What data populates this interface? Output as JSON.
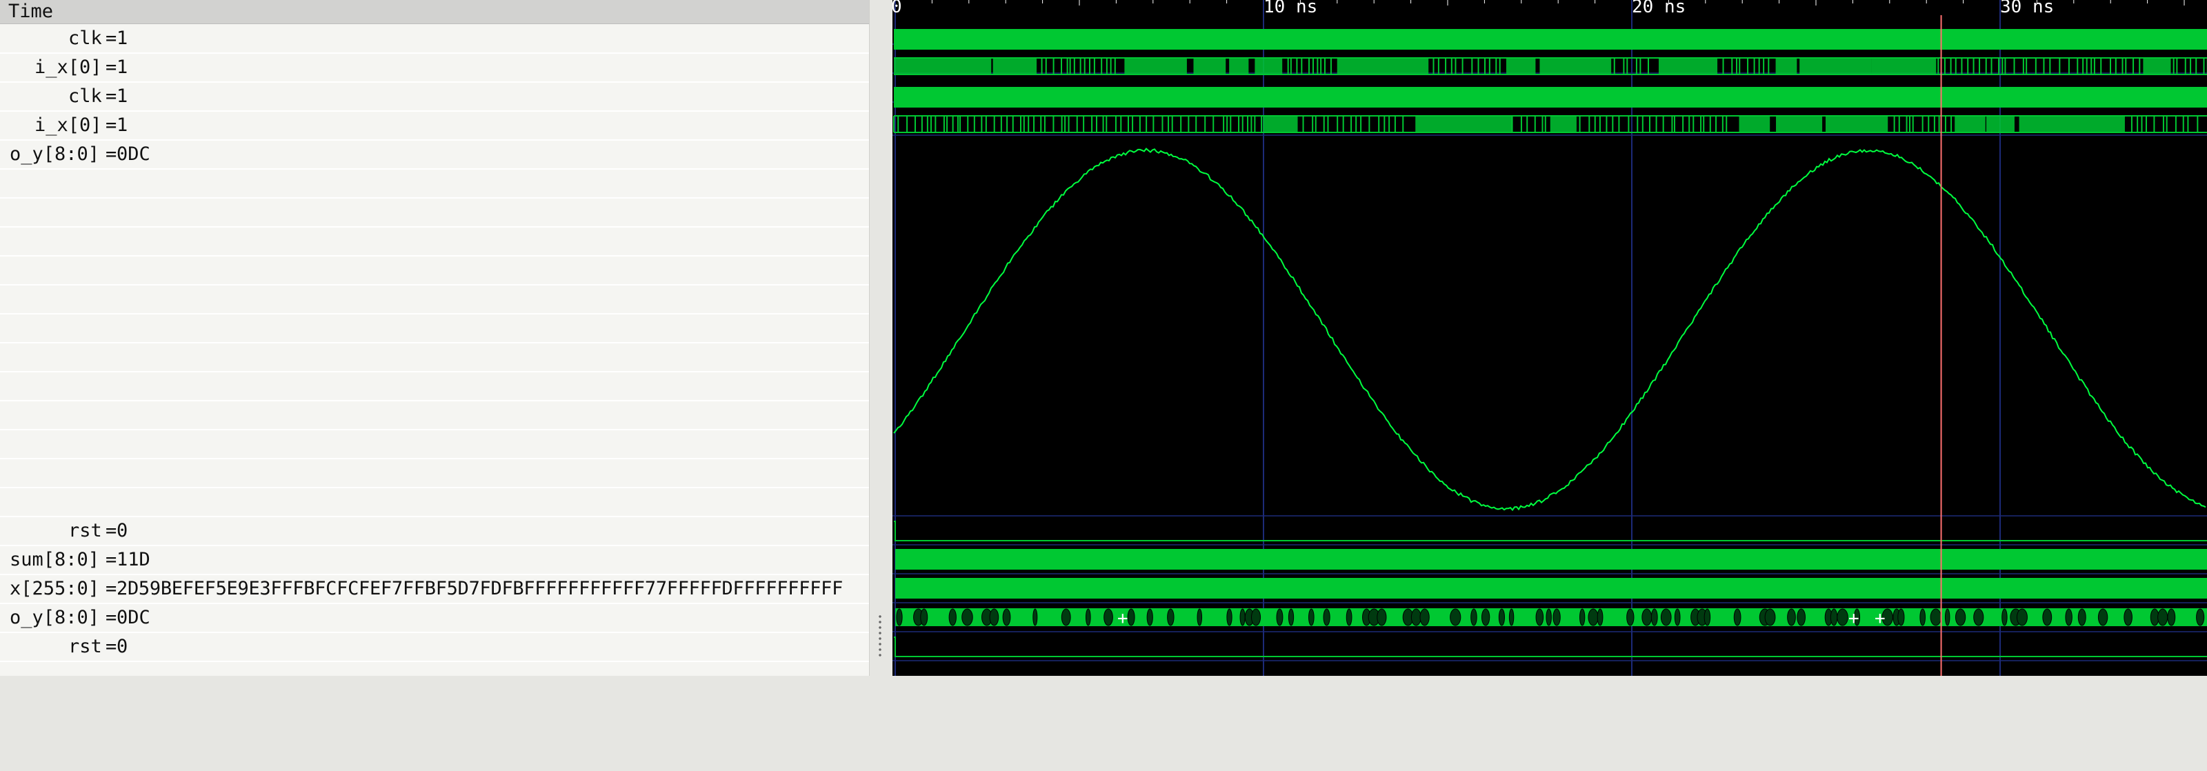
{
  "signals_panel": {
    "header": "Time",
    "rows": [
      {
        "name": "clk",
        "value": "1",
        "indent": 3
      },
      {
        "name": "i_x[0]",
        "value": "1",
        "indent": 1
      },
      {
        "name": "clk",
        "value": "1",
        "indent": 3
      },
      {
        "name": "i_x[0]",
        "value": "1",
        "indent": 1
      },
      {
        "name": "o_y[8:0]",
        "value": "0DC",
        "indent": 0,
        "analog": true
      },
      {
        "name": "rst",
        "value": "0",
        "indent": 3
      },
      {
        "name": "sum[8:0]",
        "value": "11D",
        "indent": 0
      },
      {
        "name": "x[255:0]",
        "value": "2D59BEFEF5E9E3FFFBFCFCFEF7FFBF5D7FDFBFFFFFFFFFFF77FFFFFDFFFFFFFFFF",
        "indent": 0
      },
      {
        "name": "o_y[8:0]",
        "value": "0DC",
        "indent": 0
      },
      {
        "name": "rst",
        "value": "0",
        "indent": 3
      }
    ]
  },
  "timeline": {
    "ticks": [
      {
        "t": 0,
        "label": "0"
      },
      {
        "t": 10,
        "label": "10 ns"
      },
      {
        "t": 20,
        "label": "20 ns"
      },
      {
        "t": 30,
        "label": "30 ns"
      }
    ],
    "cursor_time_ns": 28.4,
    "visible_end_ns": 35.7
  },
  "colors": {
    "wave": "#00c832",
    "wave_line": "#00ff40",
    "grid": "#1c2a78",
    "cursor": "#ff7070",
    "background": "#000000"
  },
  "icons": [
    "splitter-grip-icon",
    "bus-plus-marker-icon"
  ]
}
